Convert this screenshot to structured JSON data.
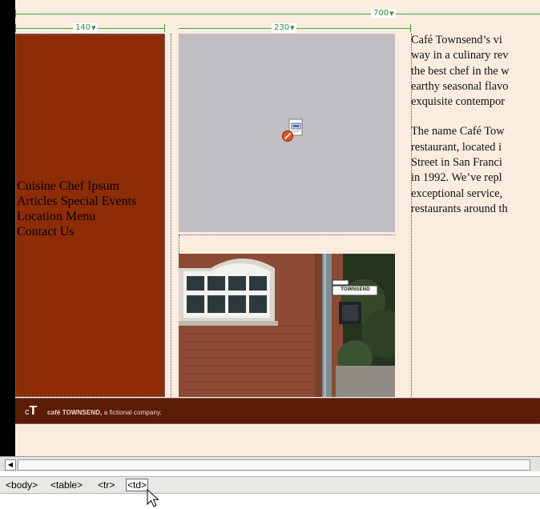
{
  "table_guides": {
    "table_width": "700",
    "sidebar_width": "140",
    "center_width": "230"
  },
  "sidebar": {
    "nav_rows": [
      [
        "Cuisine",
        "Chef Ipsum"
      ],
      [
        "Articles",
        "Special Events"
      ],
      [
        "Location",
        "Menu"
      ],
      [
        "Contact Us"
      ]
    ]
  },
  "content": {
    "paragraph1_lines": [
      "Café Townsend’s vi",
      "way in a culinary rev",
      "the best chef in the w",
      "earthy seasonal flavo",
      "exquisite contempor"
    ],
    "paragraph2_lines": [
      "The name Café Tow",
      "restaurant, located i",
      "Street in San Franci",
      "in 1992. We’ve repl",
      "exceptional service,",
      "restaurants around th"
    ]
  },
  "photo": {
    "street_sign": "TOWNSEND"
  },
  "footer": {
    "logo_c": "c",
    "logo_t": "T",
    "brand": "café TOWNSEND,",
    "tagline": " a fictional company."
  },
  "tag_selector": {
    "tags": [
      "<body>",
      "<table>",
      "<tr>",
      "<td>"
    ]
  },
  "colors": {
    "sidebar": "#8e2d05",
    "footer": "#5a1c05",
    "page_background": "#faede0",
    "guide": "#3aa63a",
    "placeholder": "#c1bfc4"
  },
  "icons": {
    "plugin": "plugin-placeholder-icon",
    "scroll_left": "scroll-left-arrow-icon",
    "cursor": "mouse-pointer-icon"
  }
}
